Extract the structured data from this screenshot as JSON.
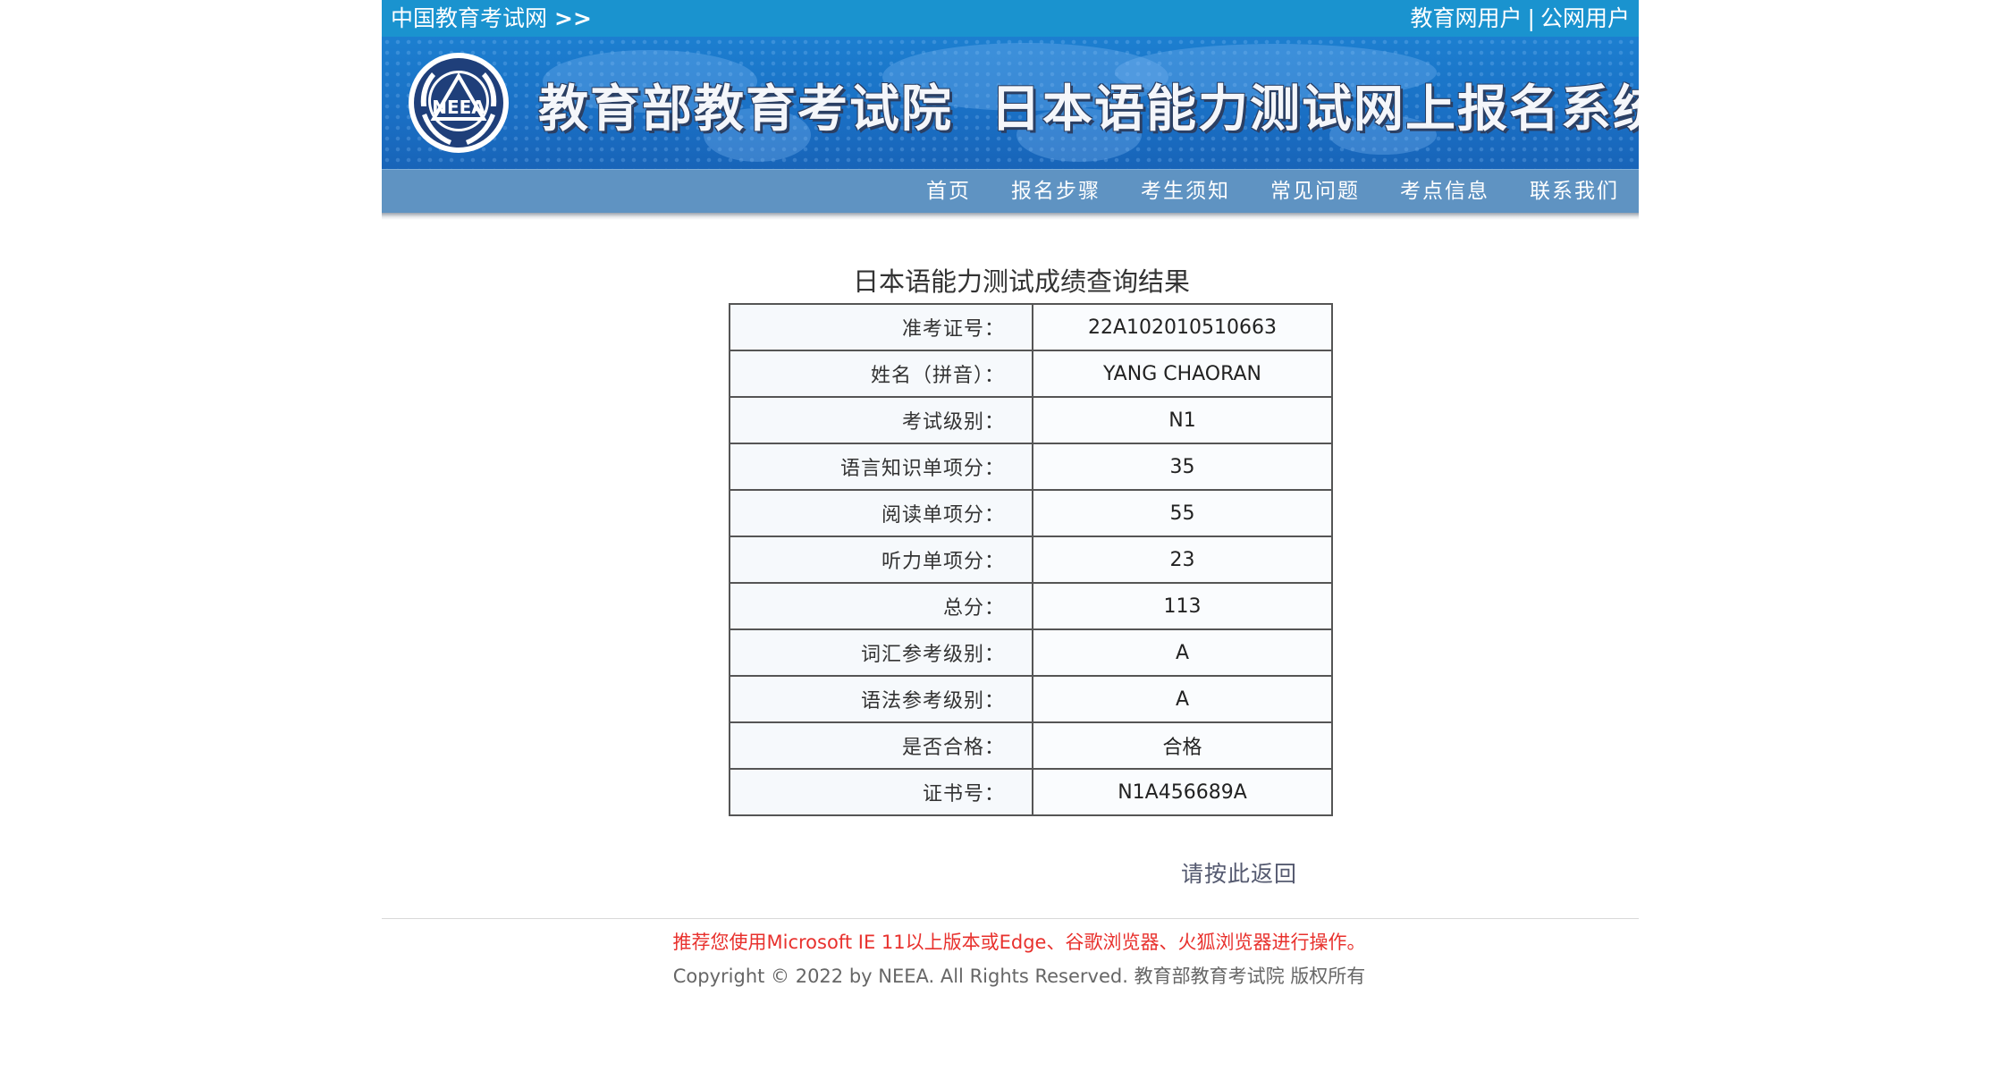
{
  "topbar": {
    "site_link": "中国教育考试网",
    "site_arrows": ">>",
    "user_edu": "教育网用户",
    "separator": "|",
    "user_public": "公网用户"
  },
  "banner": {
    "org_name": "教育部教育考试院",
    "system_name": "日本语能力测试网上报名系统",
    "logo_text": "NEEA",
    "colors": {
      "banner_blue": "#1a6fc4",
      "title_outline": "#2b3f63"
    }
  },
  "nav": {
    "items": [
      "首页",
      "报名步骤",
      "考生须知",
      "常见问题",
      "考点信息",
      "联系我们"
    ]
  },
  "result": {
    "title": "日本语能力测试成绩查询结果",
    "rows": [
      {
        "label": "准考证号：",
        "value": "22A102010510663"
      },
      {
        "label": "姓名（拼音）：",
        "value": "YANG CHAORAN"
      },
      {
        "label": "考试级别：",
        "value": "N1"
      },
      {
        "label": "语言知识单项分：",
        "value": "35"
      },
      {
        "label": "阅读单项分：",
        "value": "55"
      },
      {
        "label": "听力单项分：",
        "value": "23"
      },
      {
        "label": "总分：",
        "value": "113"
      },
      {
        "label": "词汇参考级别：",
        "value": "A"
      },
      {
        "label": "语法参考级别：",
        "value": "A"
      },
      {
        "label": "是否合格：",
        "value": "合格"
      },
      {
        "label": "证书号：",
        "value": "N1A456689A"
      }
    ],
    "back_link": "请按此返回"
  },
  "footer": {
    "recommendation": "推荐您使用Microsoft IE 11以上版本或Edge、谷歌浏览器、火狐浏览器进行操作。",
    "copyright": "Copyright © 2022 by NEEA. All Rights Reserved. 教育部教育考试院 版权所有"
  }
}
